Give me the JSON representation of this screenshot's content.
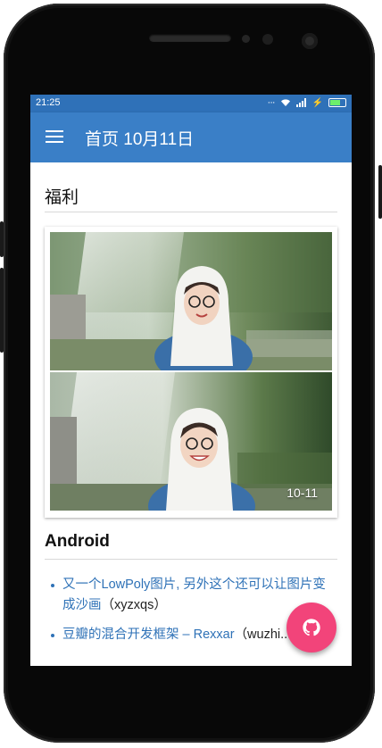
{
  "status_bar": {
    "time": "21:25",
    "battery_color": "#6cf06c"
  },
  "app_bar": {
    "title": "首页 10月11日",
    "color": "#3a7fc7"
  },
  "sections": {
    "welfare": {
      "title": "福利",
      "photo_date": "10-11"
    },
    "android": {
      "title": "Android",
      "items": [
        {
          "link_text": "又一个LowPoly图片, 另外这个还可以让图片变成沙画",
          "author": "（xyzxqs）"
        },
        {
          "link_text": "豆瓣的混合开发框架 – Rexxar",
          "author": "（wuzhi...）"
        }
      ]
    }
  },
  "fab": {
    "icon": "github-icon",
    "color": "#f2447a"
  },
  "icons": {
    "menu": "menu-icon",
    "wifi": "wifi-icon",
    "signal": "signal-icon",
    "battery": "battery-icon"
  }
}
